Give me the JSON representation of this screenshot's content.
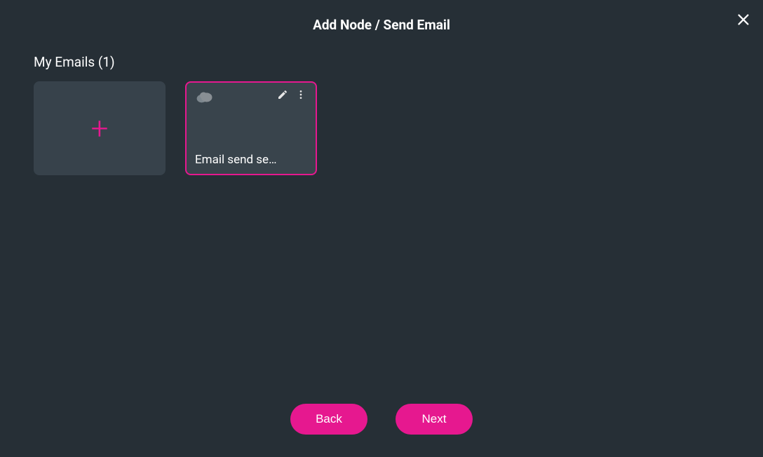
{
  "header": {
    "title": "Add Node / Send Email"
  },
  "section": {
    "title": "My Emails (1)"
  },
  "emails": [
    {
      "label": "Email send se…"
    }
  ],
  "buttons": {
    "back": "Back",
    "next": "Next"
  },
  "colors": {
    "accent": "#e6188f",
    "bg": "#262f36",
    "cardBg": "#37424b"
  }
}
